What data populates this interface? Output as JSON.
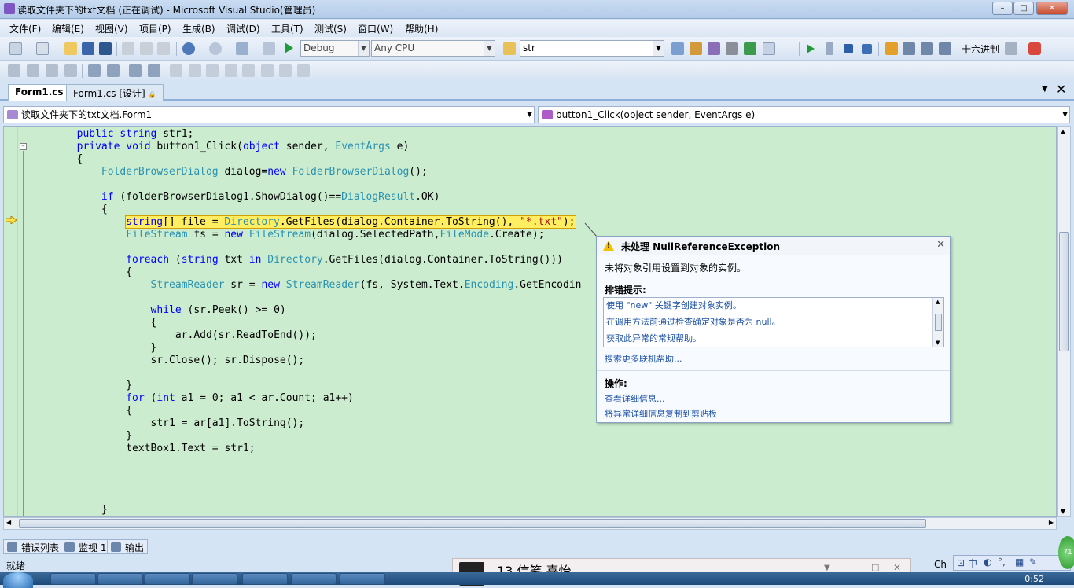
{
  "window": {
    "title": "读取文件夹下的txt文档 (正在调试) - Microsoft Visual Studio(管理员)"
  },
  "menu": [
    "文件(F)",
    "编辑(E)",
    "视图(V)",
    "项目(P)",
    "生成(B)",
    "调试(D)",
    "工具(T)",
    "测试(S)",
    "窗口(W)",
    "帮助(H)"
  ],
  "toolbar": {
    "configuration": "Debug",
    "platform": "Any CPU",
    "find_value": "str",
    "hex_label": "十六进制"
  },
  "doc_tabs": [
    {
      "label": "Form1.cs",
      "active": true
    },
    {
      "label": "Form1.cs [设计]",
      "active": false
    }
  ],
  "nav": {
    "class_combo": "读取文件夹下的txt文档.Form1",
    "member_combo": "button1_Click(object sender, EventArgs e)"
  },
  "code_lines": [
    "        public string str1;",
    "        private void button1_Click(object sender, EventArgs e)",
    "        {",
    "            FolderBrowserDialog dialog=new FolderBrowserDialog();",
    "",
    "            if (folderBrowserDialog1.ShowDialog()==DialogResult.OK)",
    "            {",
    "                string[] file = Directory.GetFiles(dialog.Container.ToString(), \"*.txt\");",
    "                FileStream fs = new FileStream(dialog.SelectedPath,FileMode.Create);",
    "",
    "                foreach (string txt in Directory.GetFiles(dialog.Container.ToString()))",
    "                {",
    "                    StreamReader sr = new StreamReader(fs, System.Text.Encoding.GetEncodin",
    "",
    "                    while (sr.Peek() >= 0)",
    "                    {",
    "                        ar.Add(sr.ReadToEnd());",
    "                    }",
    "                    sr.Close(); sr.Dispose();",
    "",
    "                }",
    "                for (int a1 = 0; a1 < ar.Count; a1++)",
    "                {",
    "                    str1 = ar[a1].ToString();",
    "                }",
    "                textBox1.Text = str1;",
    "",
    "",
    "",
    "            }"
  ],
  "exception": {
    "title": "未处理 NullReferenceException",
    "message": "未将对象引用设置到对象的实例。",
    "tips_heading": "排错提示:",
    "tips": [
      "使用 \"new\" 关键字创建对象实例。",
      "在调用方法前通过检查确定对象是否为 null。",
      "获取此异常的常规帮助。"
    ],
    "search_link": "搜索更多联机帮助...",
    "actions_heading": "操作:",
    "actions": [
      "查看详细信息...",
      "将异常详细信息复制到剪贴板"
    ]
  },
  "bottom_tabs": [
    "错误列表",
    "监视 1",
    "输出"
  ],
  "status": "就绪",
  "notification": {
    "text": "13 信笺 喜怡"
  },
  "ime": {
    "label": "Ch",
    "mode": "中"
  },
  "clock": "0:52",
  "network_badge": "71",
  "colors": {
    "editor_bg": "#cbeccf",
    "keyword": "#0000ff",
    "type": "#2b91af",
    "string": "#a31515",
    "current_line": "#ffee62",
    "link": "#1a4fa6"
  }
}
